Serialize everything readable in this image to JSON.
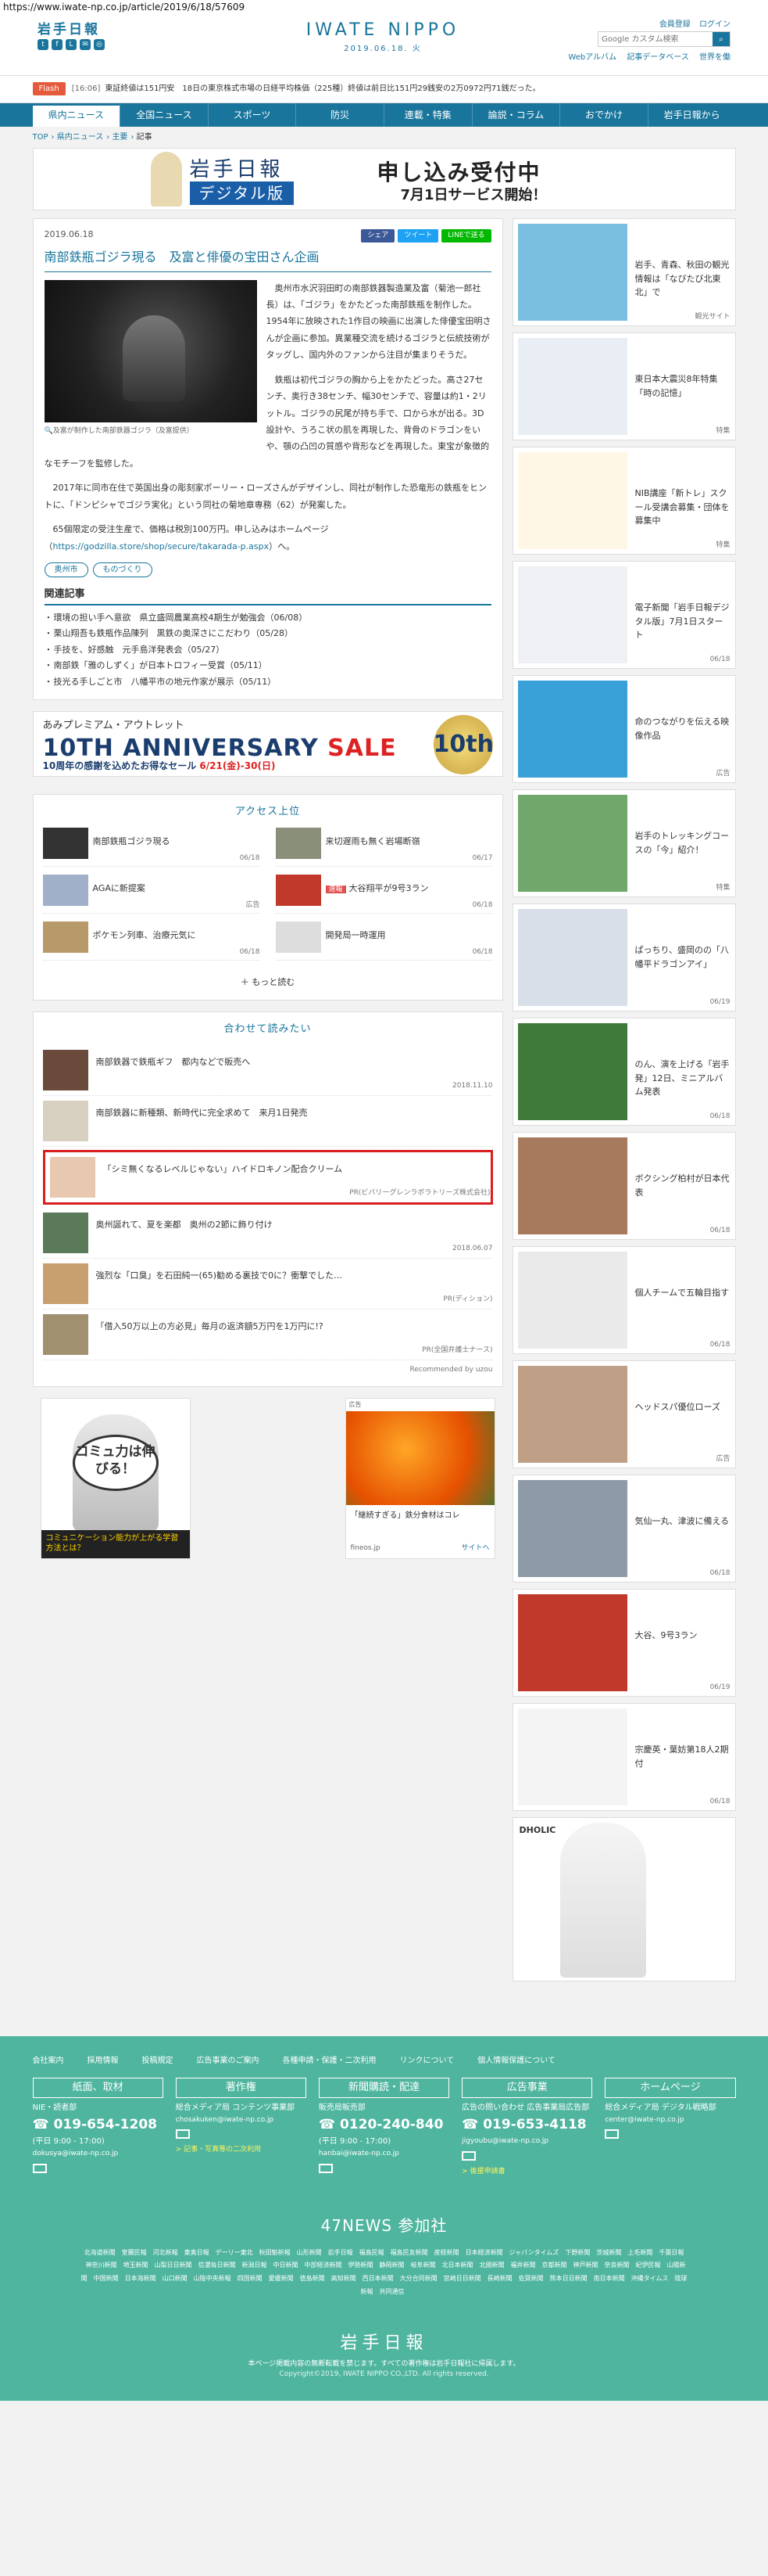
{
  "url": "https://www.iwate-np.co.jp/article/2019/6/18/57609",
  "header": {
    "logo": "岩手日報",
    "brand": "IWATE NIPPO",
    "date": "2019.06.18. 火",
    "member_reg": "会員登録",
    "login": "ログイン",
    "search_placeholder": "Google カスタム検索",
    "search_btn": "検索",
    "links": [
      "Webアルバム",
      "記事データベース",
      "世界を働"
    ]
  },
  "flash": {
    "tag": "Flash",
    "time": "[16:06]",
    "text": "東証終値は151円安　18日の東京株式市場の日経平均株価（225種）終値は前日比151円29銭安の2万0972円71銭だった。"
  },
  "nav": [
    "県内ニュース",
    "全国ニュース",
    "スポーツ",
    "防災",
    "連載・特集",
    "論説・コラム",
    "おでかけ",
    "岩手日報から"
  ],
  "breadcrumb": [
    "TOP",
    "県内ニュース",
    "主要",
    "記事"
  ],
  "banner": {
    "paper": "岩手日報",
    "digital": "デジタル版",
    "main": "申し込み受付中",
    "sub": "7月1日サービス開始！"
  },
  "article": {
    "date": "2019.06.18",
    "share": [
      "シェア",
      "ツイート",
      "LINEで送る"
    ],
    "title": "南部鉄瓶ゴジラ現る　及富と俳優の宝田さん企画",
    "caption": "及富が制作した南部鉄器ゴジラ（及富提供）",
    "p1": "奥州市水沢羽田町の南部鉄器製造業及富（菊池一郎社長）は、「ゴジラ」をかたどった南部鉄瓶を制作した。1954年に放映された1作目の映画に出演した俳優宝田明さんが企画に参加。異業種交流を続けるゴジラと伝統技術がタッグし、国内外のファンから注目が集まりそうだ。",
    "p2": "鉄瓶は初代ゴジラの胸から上をかたどった。高さ27センチ、奥行き38センチ、幅30センチで、容量は約1・2リットル。ゴジラの尻尾が持ち手で、口から水が出る。3D設計や、うろこ状の肌を再現した、背骨のドラゴンをいや、顎の凸凹の質感や背形などを再現した。東宝が象徴的なモチーフを監修した。",
    "p3": "2017年に同市在住で英国出身の彫刻家ポーリー・ローズさんがデザインし、同社が制作した恐竜形の鉄瓶をヒントに、「ドンピシャでゴジラ実化」という同社の菊地章専務（62）が発案した。",
    "p4_pre": "65個限定の受注生産で、価格は税別100万円。申し込みはホームページ（",
    "p4_link": "https://godzilla.store/shop/secure/takarada-p.aspx",
    "p4_post": "）へ。",
    "tags": [
      "奥州市",
      "ものづくり"
    ]
  },
  "related": {
    "title": "関連記事",
    "items": [
      "環境の担い手へ意欲　県立盛岡農業高校4期生が勉強会（06/08）",
      "栗山翔吾も鉄瓶作品陳列　黒鉄の奥深さにこだわり（05/28）",
      "手技を、好感触　元手島洋発表会（05/27）",
      "南部鉄「雅のしずく」が日本トロフィー受賞（05/11）",
      "技光る手しごと市　八幡平市の地元作家が展示（05/11）"
    ]
  },
  "ad_sale": {
    "t1": "あみプレミアム・アウトレット",
    "t2a": "10TH ANNIVERSARY",
    "t2b": "SALE",
    "t3a": "10周年の感謝を込めたお得なセール",
    "t3b": "6/21(金)-30(日)",
    "ten": "10th"
  },
  "access": {
    "title": "アクセス上位",
    "items": [
      {
        "title": "南部鉄瓶ゴジラ現る",
        "date": "06/18",
        "badge": ""
      },
      {
        "title": "来切遅雨も無く岩場断嶺",
        "date": "06/17",
        "badge": ""
      },
      {
        "title": "AGAに新提案",
        "date": "広告",
        "badge": ""
      },
      {
        "title": "大谷翔平が9号3ラン",
        "date": "06/18",
        "badge": "速報"
      },
      {
        "title": "ポケモン列車、治療元気に",
        "date": "06/18",
        "badge": ""
      },
      {
        "title": "開発局一時運用",
        "date": "06/18",
        "badge": ""
      }
    ],
    "more": "もっと読む"
  },
  "reco": {
    "title": "合わせて読みたい",
    "items": [
      {
        "title": "南部鉄器で鉄瓶ギフ　都内などで販売へ",
        "meta": "2018.11.10",
        "hl": false
      },
      {
        "title": "南部鉄器に新種類、新時代に完全求めて　来月1日発売",
        "meta": "",
        "hl": false
      },
      {
        "title": "「シミ無くなるレベルじゃない」ハイドロキノン配合クリーム",
        "meta": "PR(ビバリーグレンラボラトリーズ株式会社)",
        "hl": true
      },
      {
        "title": "奥州誕れて、夏を楽都　奥州の2節に飾り付け",
        "meta": "2018.06.07",
        "hl": false
      },
      {
        "title": "強烈な「口臭」を石田純一(65)勧める裏技で0に？衝撃でした…",
        "meta": "PR(ディション)",
        "hl": false
      },
      {
        "title": "「借入50万以上の方必見」毎月の返済額5万円を1万円に!?",
        "meta": "PR(全国弁護士ナース)",
        "hl": false
      }
    ],
    "powered": "Recommended by uzou"
  },
  "ad_comm": {
    "bubble": "コミュ力は伸びる！",
    "btm": "コミュニケーション能力が上がる学習方法とは？"
  },
  "ad_food": {
    "label": "広告",
    "title": "「継続すぎる」鉄分食材はコレ",
    "source": "fineos.jp",
    "site": "サイトへ"
  },
  "sidebar": [
    {
      "title": "岩手、青森、秋田の観光情報は「なびたび北東北」で",
      "date": "観光サイト",
      "color": "#7bbfe0"
    },
    {
      "title": "東日本大震災8年特集「時の記憶」",
      "date": "特集",
      "color": "#e8eef4"
    },
    {
      "title": "NIB講座「新トレ」スクール受講会募集・団体を募集中",
      "date": "特集",
      "color": "#fff7e6"
    },
    {
      "title": "電子新聞「岩手日報デジタル版」7月1日スタート",
      "date": "06/18",
      "color": "#eef0f4"
    },
    {
      "title": "命のつながりを伝える映像作品",
      "date": "広告",
      "color": "#3aa0d8"
    },
    {
      "title": "岩手のトレッキングコースの「今」紹介！",
      "date": "特集",
      "color": "#6fa86a"
    },
    {
      "title": "ぱっちり、盛岡のの「八幡平ドラゴンアイ」",
      "date": "06/19",
      "color": "#d8dfe8"
    },
    {
      "title": "のん、演を上げる「岩手発」12日、ミニアルバム発表",
      "date": "06/18",
      "color": "#3f7a3a"
    },
    {
      "title": "ボクシング柏村が日本代表",
      "date": "06/18",
      "color": "#a77a5e"
    },
    {
      "title": "個人チームで五輪目指す",
      "date": "06/18",
      "color": "#eaeaea"
    },
    {
      "title": "ヘッドスパ優位ローズ",
      "date": "広告",
      "color": "#bfa086"
    },
    {
      "title": "気仙一丸、津波に備える",
      "date": "06/18",
      "color": "#8f9aa8"
    },
    {
      "title": "大谷、9号3ラン",
      "date": "06/19",
      "color": "#c0392b"
    },
    {
      "title": "宗慶英・葉妨第18人2期付",
      "date": "06/18",
      "color": "#f4f4f4"
    }
  ],
  "side_ad": {
    "logo": "DHOLIC"
  },
  "footer": {
    "links": [
      "会社案内",
      "採用情報",
      "投稿規定",
      "広告事業のご案内",
      "各種申請・保護・二次利用",
      "リンクについて",
      "個人情報保護について"
    ],
    "cols": [
      {
        "head": "紙面、取材",
        "sub": "NIE・読者部",
        "tel": "019-654-1208",
        "hours": "(平日 9:00 - 17:00)",
        "mail": "dokusya@iwate-np.co.jp",
        "note": ""
      },
      {
        "head": "著作権",
        "sub": "総合メディア局 コンテンツ事業部",
        "tel": "",
        "hours": "",
        "mail": "chosakuken@iwate-np.co.jp",
        "note": "> 記事・写真等の二次利用"
      },
      {
        "head": "新聞購読・配達",
        "sub": "販売局販売部",
        "tel": "0120-240-840",
        "hours": "(平日 9:00 - 17:00)",
        "mail": "hanbai@iwate-np.co.jp",
        "note": ""
      },
      {
        "head": "広告事業",
        "sub": "広告の問い合わせ 広告事業局広告部",
        "tel": "019-653-4118",
        "hours": "",
        "mail": "jigyoubu@iwate-np.co.jp",
        "note": "> 後援申請書"
      },
      {
        "head": "ホームページ",
        "sub": "総合メディア局 デジタル戦略部",
        "tel": "",
        "hours": "",
        "mail": "center@iwate-np.co.jp",
        "note": ""
      }
    ],
    "news47_title": "47NEWS 参加社",
    "news47": [
      "北海道新聞",
      "室蘭民報",
      "河北新報",
      "東奥日報",
      "デーリー東北",
      "秋田魁新報",
      "山形新聞",
      "岩手日報",
      "福島民報",
      "福島民友新聞",
      "産経新聞",
      "日本経済新聞",
      "ジャパンタイムズ",
      "下野新聞",
      "茨城新聞",
      "上毛新聞",
      "千葉日報",
      "神奈川新聞",
      "埼玉新聞",
      "山梨日日新聞",
      "信濃毎日新聞",
      "新潟日報",
      "中日新聞",
      "中部経済新聞",
      "伊勢新聞",
      "静岡新聞",
      "岐阜新聞",
      "北日本新聞",
      "北國新聞",
      "福井新聞",
      "京都新聞",
      "神戸新聞",
      "奈良新聞",
      "紀伊民報",
      "山陽新聞",
      "中国新聞",
      "日本海新聞",
      "山口新聞",
      "山陰中央新報",
      "四国新聞",
      "愛媛新聞",
      "徳島新聞",
      "高知新聞",
      "西日本新聞",
      "大分合同新聞",
      "宮崎日日新聞",
      "長崎新聞",
      "佐賀新聞",
      "熊本日日新聞",
      "南日本新聞",
      "沖縄タイムス",
      "琉球新報",
      "共同通信"
    ],
    "logo": "岩手日報",
    "note": "本ページ掲載内容の無断転載を禁じます。すべての著作権は岩手日報社に帰属します。",
    "copy": "Copyright©2019, IWATE NIPPO CO.,LTD. All rights reserved."
  }
}
